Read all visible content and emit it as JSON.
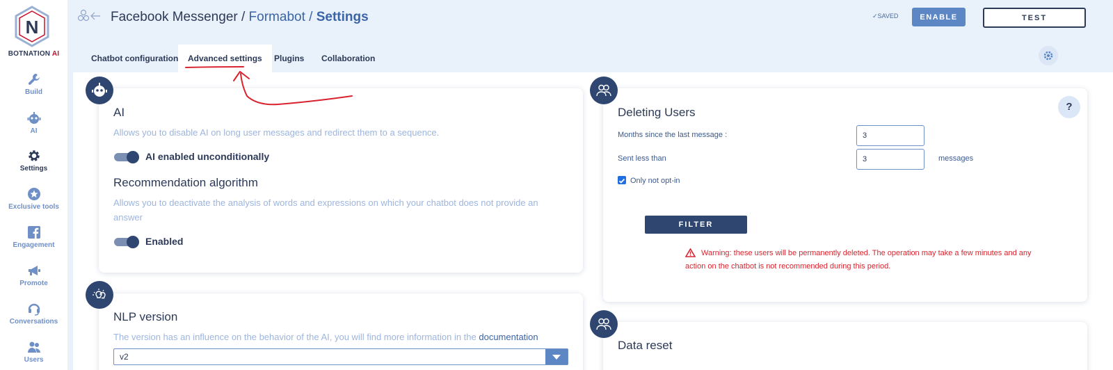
{
  "brand": {
    "name_a": "BOTNATION",
    "name_b": " AI",
    "logo_letter": "N"
  },
  "sidebar": {
    "items": [
      {
        "label": "Build",
        "icon": "wrench-icon"
      },
      {
        "label": "AI",
        "icon": "robot-icon"
      },
      {
        "label": "Settings",
        "icon": "gear-icon",
        "active": true
      },
      {
        "label": "Exclusive tools",
        "icon": "star-icon"
      },
      {
        "label": "Engagement",
        "icon": "facebook-icon"
      },
      {
        "label": "Promote",
        "icon": "megaphone-icon"
      },
      {
        "label": "Conversations",
        "icon": "headset-icon"
      },
      {
        "label": "Users",
        "icon": "users-icon"
      }
    ]
  },
  "header": {
    "breadcrumb_a": "Facebook Messenger / ",
    "breadcrumb_b": "Formabot / ",
    "breadcrumb_c": "Settings",
    "saved": "✓SAVED",
    "enable_label": "ENABLE",
    "test_label": "TEST"
  },
  "tabs": [
    {
      "label": "Chatbot configuration"
    },
    {
      "label": "Advanced settings",
      "active": true
    },
    {
      "label": "Plugins"
    },
    {
      "label": "Collaboration"
    }
  ],
  "ai_card": {
    "title": "AI",
    "desc": "Allows you to disable AI on long user messages and redirect them to a sequence.",
    "toggle_label": "AI enabled unconditionally",
    "rec_title": "Recommendation algorithm",
    "rec_desc": "Allows you to deactivate the analysis of words and expressions on which your chatbot does not provide an answer",
    "rec_toggle_label": "Enabled"
  },
  "nlp_card": {
    "title": "NLP version",
    "desc": "The version has an influence on the behavior of the AI, you will find more information in the ",
    "link": "documentation",
    "select_value": "v2"
  },
  "delete_card": {
    "title": "Deleting Users",
    "months_label": "Months since the last message :",
    "months_value": "3",
    "sent_label": "Sent less than",
    "sent_value": "3",
    "messages_label": "messages",
    "optin_label": "Only not opt-in",
    "filter_label": "FILTER",
    "warning": "Warning: these users will be permanently deleted. The operation may take a few minutes and any action on the chatbot is not recommended during this period.",
    "help": "?"
  },
  "reset_card": {
    "title": "Data reset"
  },
  "colors": {
    "primary": "#2e4670",
    "accent": "#5d86c5",
    "danger": "#d9232e",
    "annotation": "#d9232e"
  }
}
